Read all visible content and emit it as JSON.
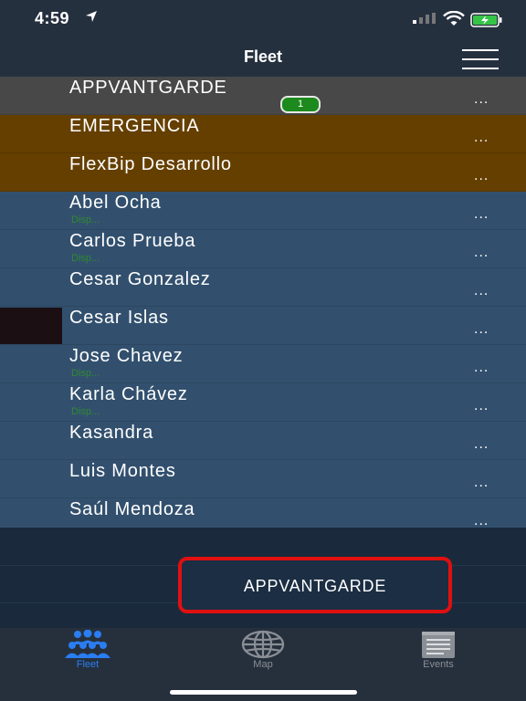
{
  "status_bar": {
    "time": "4:59"
  },
  "nav": {
    "title": "Fleet"
  },
  "list": {
    "group": {
      "label": "APPVANTGARDE",
      "badge": "1",
      "more": "..."
    },
    "emergency": {
      "label": "EMERGENCIA",
      "more": "..."
    },
    "dev": {
      "label": "FlexBip Desarrollo",
      "more": "..."
    },
    "vehicles": [
      {
        "label": "Abel Ocha",
        "sub": "Disp...",
        "more": "..."
      },
      {
        "label": "Carlos Prueba",
        "sub": "Disp...",
        "more": "..."
      },
      {
        "label": "Cesar Gonzalez",
        "sub": "",
        "more": "..."
      },
      {
        "label": "Cesar Islas",
        "sub": "",
        "more": "..."
      },
      {
        "label": "Jose Chavez",
        "sub": "Disp...",
        "more": "..."
      },
      {
        "label": "Karla Chávez",
        "sub": "Disp...",
        "more": "..."
      },
      {
        "label": "Kasandra",
        "sub": "",
        "more": "..."
      },
      {
        "label": "Luis Montes",
        "sub": "",
        "more": "..."
      },
      {
        "label": "Saúl Mendoza",
        "sub": "",
        "more": "..."
      }
    ]
  },
  "floating_button": {
    "label": "APPVANTGARDE"
  },
  "tabs": [
    {
      "label": "Fleet",
      "icon": "people-icon",
      "active": true,
      "color": "#2a7df2"
    },
    {
      "label": "Map",
      "icon": "globe-icon",
      "active": false,
      "color": "#8a8f96"
    },
    {
      "label": "Events",
      "icon": "notepad-icon",
      "active": false,
      "color": "#8a8f96"
    }
  ],
  "colors": {
    "accent": "#2a7df2",
    "group_row": "#484848",
    "emergency_row": "#653f00",
    "vehicle_row": "#32506e",
    "highlight_border": "#e01010",
    "badge": "#1c8a1c"
  }
}
